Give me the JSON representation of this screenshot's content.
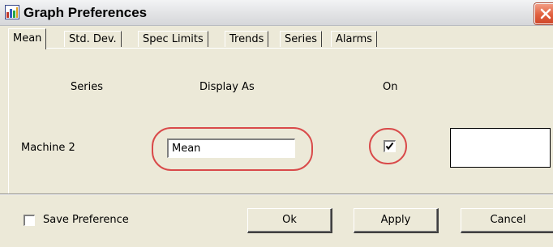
{
  "window": {
    "title": "Graph Preferences"
  },
  "tabs": [
    "Mean",
    "Std. Dev.",
    "Spec Limits",
    "Trends",
    "Series",
    "Alarms"
  ],
  "active_tab": "Mean",
  "columns": {
    "series": "Series",
    "display_as": "Display As",
    "on": "On"
  },
  "row": {
    "series_name": "Machine 2",
    "display_as_value": "Mean",
    "on_checked": true,
    "color": "#ffffff"
  },
  "footer": {
    "save_preference_label": "Save Preference",
    "save_preference_checked": false
  },
  "buttons": {
    "ok": "Ok",
    "apply": "Apply",
    "cancel": "Cancel"
  },
  "colors": {
    "highlight": "#d94a4a",
    "close_button": "#e1603f",
    "dialog_bg": "#ece9d8"
  },
  "icons": {
    "title": "graph-preferences-app-icon",
    "close": "close-icon"
  }
}
